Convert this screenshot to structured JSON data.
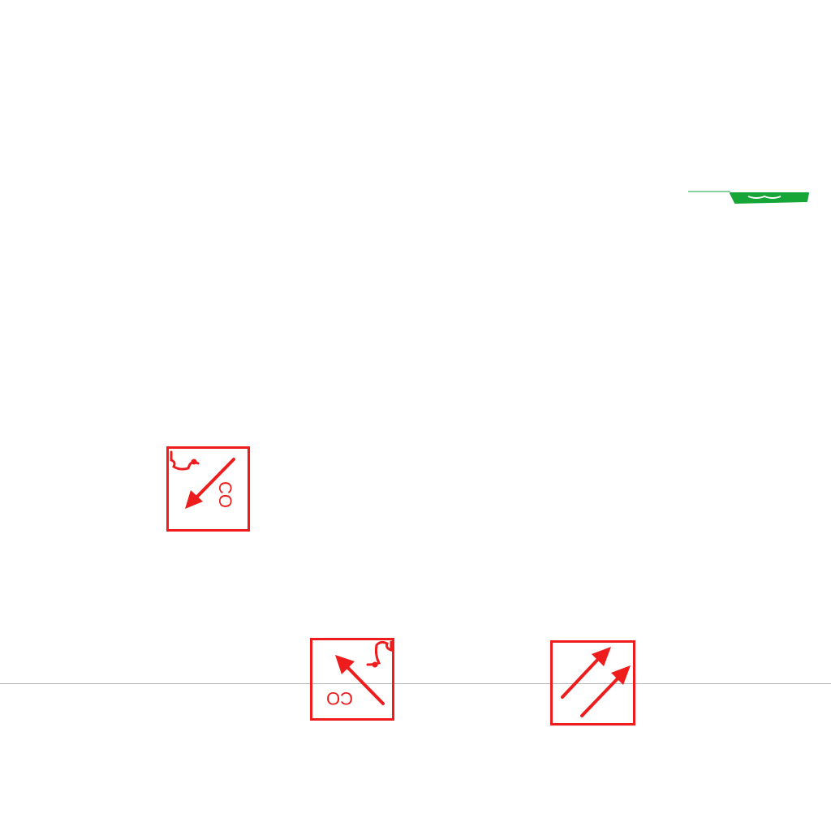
{
  "diagram": {
    "symbols": [
      {
        "id": "co-detector-down-left",
        "label": "CO"
      },
      {
        "id": "co-detector-up-left",
        "label": "CO"
      },
      {
        "id": "double-arrow-up-right",
        "label": ""
      }
    ],
    "colors": {
      "symbol": "#ee1c1c",
      "marker": "#16a637",
      "baseline": "#b3b3b3",
      "background": "#ffffff"
    }
  }
}
